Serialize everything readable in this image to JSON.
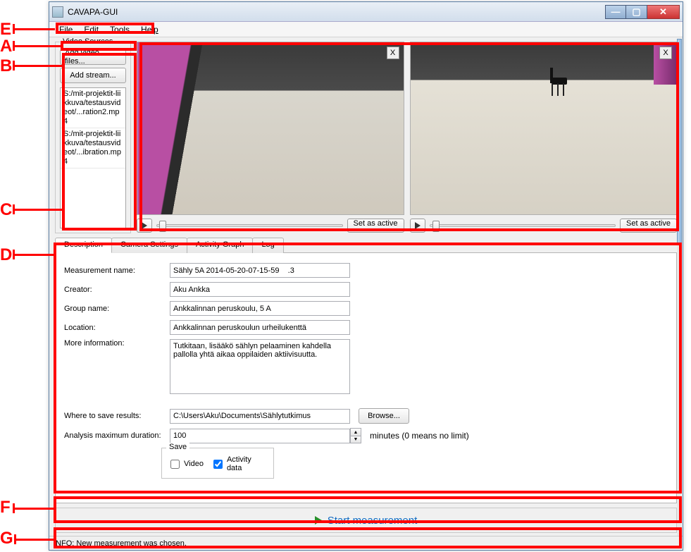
{
  "annotations": {
    "A": "A",
    "B": "B",
    "C": "C",
    "D": "D",
    "E": "E",
    "F": "F",
    "G": "G"
  },
  "window": {
    "title": "CAVAPA-GUI"
  },
  "menu": {
    "file": "File",
    "edit": "Edit",
    "tools": "Tools",
    "help": "Help"
  },
  "sidebar": {
    "title": "Video Sources",
    "add_files": "Add video files...",
    "add_stream": "Add stream...",
    "items": [
      "S:/mit-projektit-liikkuva/testausvideot/...ration2.mp4",
      "S:/mit-projektit-liikkuva/testausvideot/...ibration.mp4"
    ]
  },
  "video": {
    "close_x": "X",
    "set_active": "Set as active"
  },
  "tabs": {
    "description": "Description",
    "camera": "Camera Settings",
    "activity": "Activity Graph",
    "log": "Log"
  },
  "form": {
    "meas_name_lbl": "Measurement name:",
    "meas_name": "Sähly 5A 2014-05-20-07-15-59    .3",
    "creator_lbl": "Creator:",
    "creator": "Aku Ankka",
    "group_lbl": "Group name:",
    "group": "Ankkalinnan peruskoulu, 5 A",
    "location_lbl": "Location:",
    "location": "Ankkalinnan peruskoulun urheilukenttä",
    "more_lbl": "More information:",
    "more": "Tutkitaan, lisääkö sählyn pelaaminen kahdella pallolla yhtä aikaa oppilaiden aktiivisuutta.",
    "save_path_lbl": "Where to save results:",
    "save_path": "C:\\Users\\Aku\\Documents\\Sählytutkimus",
    "browse": "Browse...",
    "duration_lbl": "Analysis maximum duration:",
    "duration": "100",
    "duration_suffix": "minutes (0 means no limit)",
    "save_title": "Save",
    "video_chk": "Video",
    "activity_chk": "Activity data"
  },
  "start": {
    "label": "Start measurement"
  },
  "status": {
    "text": "INFO: New measurement was chosen."
  }
}
